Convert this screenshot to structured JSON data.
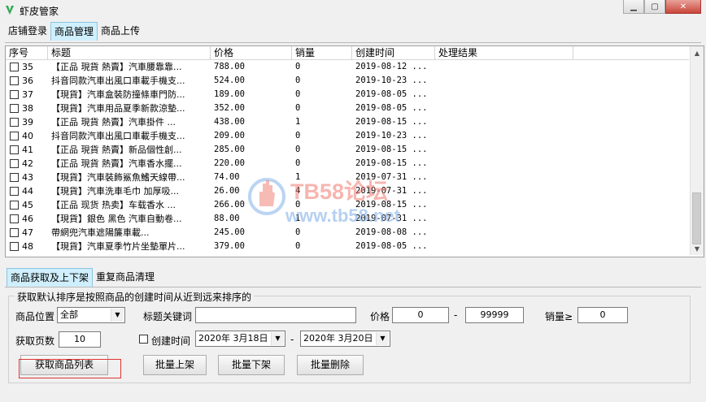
{
  "window": {
    "title": "虾皮管家",
    "icon": "shrimp-logo-icon"
  },
  "top_tabs": [
    "店铺登录",
    "商品管理",
    "商品上传"
  ],
  "list": {
    "columns": [
      "序号",
      "标题",
      "价格",
      "销量",
      "创建时间",
      "处理结果"
    ],
    "rows": [
      {
        "id": "35",
        "title": "【正品 現貨 熱賣】汽車腰靠靠...",
        "price": "788.00",
        "sales": "0",
        "created": "2019-08-12 ..."
      },
      {
        "id": "36",
        "title": "抖音同款汽車出風口車載手機支...",
        "price": "524.00",
        "sales": "0",
        "created": "2019-10-23 ..."
      },
      {
        "id": "37",
        "title": "【現貨】汽車盒裝防撞條車門防...",
        "price": "189.00",
        "sales": "0",
        "created": "2019-08-05 ..."
      },
      {
        "id": "38",
        "title": "【現貨】汽車用品夏季新款涼墊...",
        "price": "352.00",
        "sales": "0",
        "created": "2019-08-05 ..."
      },
      {
        "id": "39",
        "title": "【正品 現貨 熱賣】汽車掛件 ...",
        "price": "438.00",
        "sales": "1",
        "created": "2019-08-15 ..."
      },
      {
        "id": "40",
        "title": "抖音同款汽車出風口車載手機支...",
        "price": "209.00",
        "sales": "0",
        "created": "2019-10-23 ..."
      },
      {
        "id": "41",
        "title": "【正品 現貨 熱賣】新品個性創...",
        "price": "285.00",
        "sales": "0",
        "created": "2019-08-15 ..."
      },
      {
        "id": "42",
        "title": "【正品 現貨 熱賣】汽車香水擺...",
        "price": "220.00",
        "sales": "0",
        "created": "2019-08-15 ..."
      },
      {
        "id": "43",
        "title": "【現貨】汽車裝飾鯊魚鰭天線帶...",
        "price": "74.00",
        "sales": "1",
        "created": "2019-07-31 ..."
      },
      {
        "id": "44",
        "title": "【現貨】汽車洗車毛巾 加厚吸...",
        "price": "26.00",
        "sales": "4",
        "created": "2019-07-31 ..."
      },
      {
        "id": "45",
        "title": "【正品 现货 热卖】车载香水 ...",
        "price": "266.00",
        "sales": "0",
        "created": "2019-08-15 ..."
      },
      {
        "id": "46",
        "title": "【現貨】銀色 黑色 汽車自動卷...",
        "price": "88.00",
        "sales": "1",
        "created": "2019-07-31 ..."
      },
      {
        "id": "47",
        "title": "帶網兜汽車遮陽簾車載...",
        "price": "245.00",
        "sales": "0",
        "created": "2019-08-08 ..."
      },
      {
        "id": "48",
        "title": "【現貨】汽車夏季竹片坐墊單片...",
        "price": "379.00",
        "sales": "0",
        "created": "2019-08-05 ..."
      }
    ]
  },
  "watermark": {
    "line1": "TB58论坛",
    "line2": "www.tb58.net"
  },
  "bottom_tabs": [
    "商品获取及上下架",
    "重复商品清理"
  ],
  "group_title": "获取默认排序是按照商品的创建时间从近到远来排序的",
  "filters": {
    "location_label": "商品位置",
    "location_value": "全部",
    "keyword_label": "标题关键词",
    "keyword_value": "",
    "price_label": "价格",
    "price_min": "0",
    "price_sep": "-",
    "price_max": "99999",
    "sales_label": "销量≥",
    "sales_min": "0",
    "pages_label": "获取页数",
    "pages_value": "10",
    "created_label": "创建时间",
    "date_from": "2020年 3月18日",
    "date_sep": "-",
    "date_to": "2020年 3月20日"
  },
  "buttons": {
    "fetch": "获取商品列表",
    "batch_list": "批量上架",
    "batch_delist": "批量下架",
    "batch_delete": "批量删除"
  },
  "colors": {
    "active_tab_bg": "#cfeffd",
    "highlight_border": "#e03434"
  }
}
